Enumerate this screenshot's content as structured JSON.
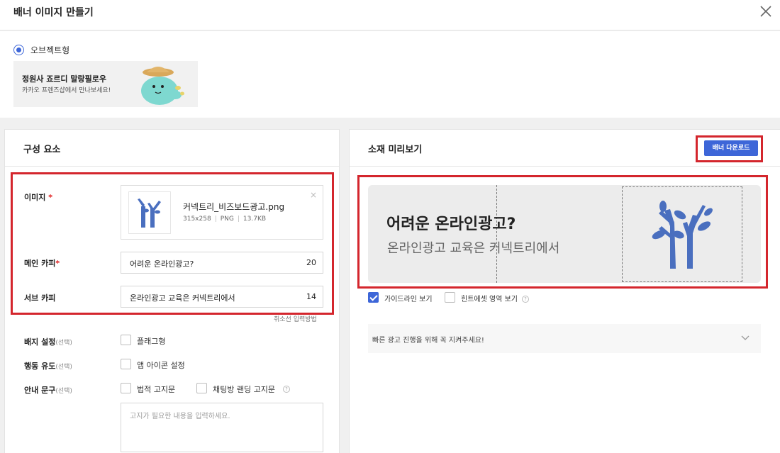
{
  "header": {
    "title": "배너 이미지 만들기"
  },
  "banner_type": {
    "label": "오브젝트형",
    "sample": {
      "title": "정원사 죠르디 말랑필로우",
      "subtitle": "카카오 프렌즈샵에서 만나보세요!"
    }
  },
  "left_panel": {
    "title": "구성 요소",
    "image": {
      "label": "이미지",
      "required_mark": "*",
      "file_name": "커넥트리_비즈보드광고.png",
      "dimensions": "315x258",
      "format": "PNG",
      "size": "13.7KB",
      "separator": "|",
      "remove_icon": "×"
    },
    "main_copy": {
      "label": "메인 카피",
      "required_mark": "*",
      "value": "어려운 온라인광고?",
      "count": "20"
    },
    "sub_copy": {
      "label": "서브 카피",
      "value": "온라인광고 교육은 커넥트리에서",
      "count": "14"
    },
    "help_link": "취소선 입력방법",
    "badge": {
      "label": "배지 설정",
      "optional": "(선택)",
      "option": "플래그형"
    },
    "action": {
      "label": "행동 유도",
      "optional": "(선택)",
      "option": "앱 아이콘 설정"
    },
    "notice": {
      "label": "안내 문구",
      "optional": "(선택)",
      "option1": "법적 고지문",
      "option2": "채팅방 랜딩 고지문",
      "info_icon": "?",
      "placeholder": "고지가 필요한 내용을 입력하세요."
    }
  },
  "right_panel": {
    "title": "소재 미리보기",
    "download_button": "배너 다운로드",
    "preview": {
      "main": "어려운 온라인광고?",
      "sub": "온라인광고 교육은 커넥트리에서"
    },
    "guide_option": {
      "label": "가이드라인 보기",
      "checked": true
    },
    "hint_option": {
      "label": "힌트에셋 영역 보기",
      "checked": false,
      "info_icon": "?"
    },
    "notice_bar": "빠른 광고 진행을 위해 꼭 지켜주세요!"
  },
  "colors": {
    "accent": "#3d66d8",
    "highlight": "#d4262d",
    "required": "#e02020",
    "tree": "#4a6fbf"
  },
  "icons": [
    "close-icon",
    "radio-icon",
    "tree-icon",
    "remove-icon",
    "checkbox-icon",
    "info-icon",
    "chevron-down-icon"
  ]
}
